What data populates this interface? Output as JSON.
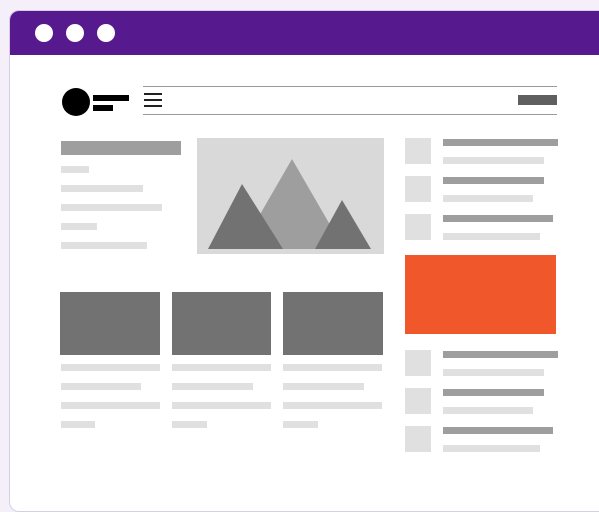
{
  "window": {
    "title_bar_color": "#571a8e",
    "controls": [
      "window-control",
      "window-control",
      "window-control"
    ]
  },
  "header": {
    "logo": "logo-icon",
    "menu_icon": "hamburger-icon"
  },
  "hero": {
    "image": "mountain-image-icon",
    "colors": [
      "#727272",
      "#9e9e9e",
      "#727272"
    ]
  },
  "ad": {
    "color": "#f0582b"
  }
}
